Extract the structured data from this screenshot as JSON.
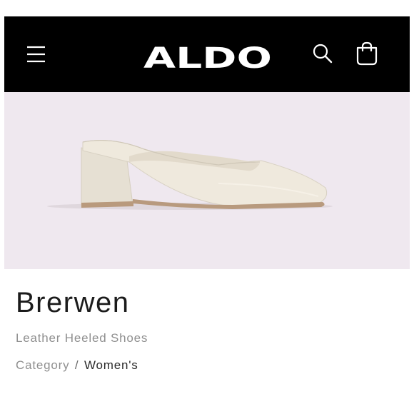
{
  "header": {
    "brand": "ALDO",
    "menu_icon": "hamburger-menu-icon",
    "search_icon": "search-icon",
    "bag_icon": "shopping-bag-icon",
    "background": "#000000",
    "foreground": "#ffffff"
  },
  "product": {
    "name": "Brerwen",
    "description": "Leather Heeled Shoes",
    "image_background": "#efe8ef",
    "shoe_color": "#ece6d9"
  },
  "breadcrumb": {
    "category_label": "Category",
    "separator": "/",
    "current": "Women's"
  }
}
